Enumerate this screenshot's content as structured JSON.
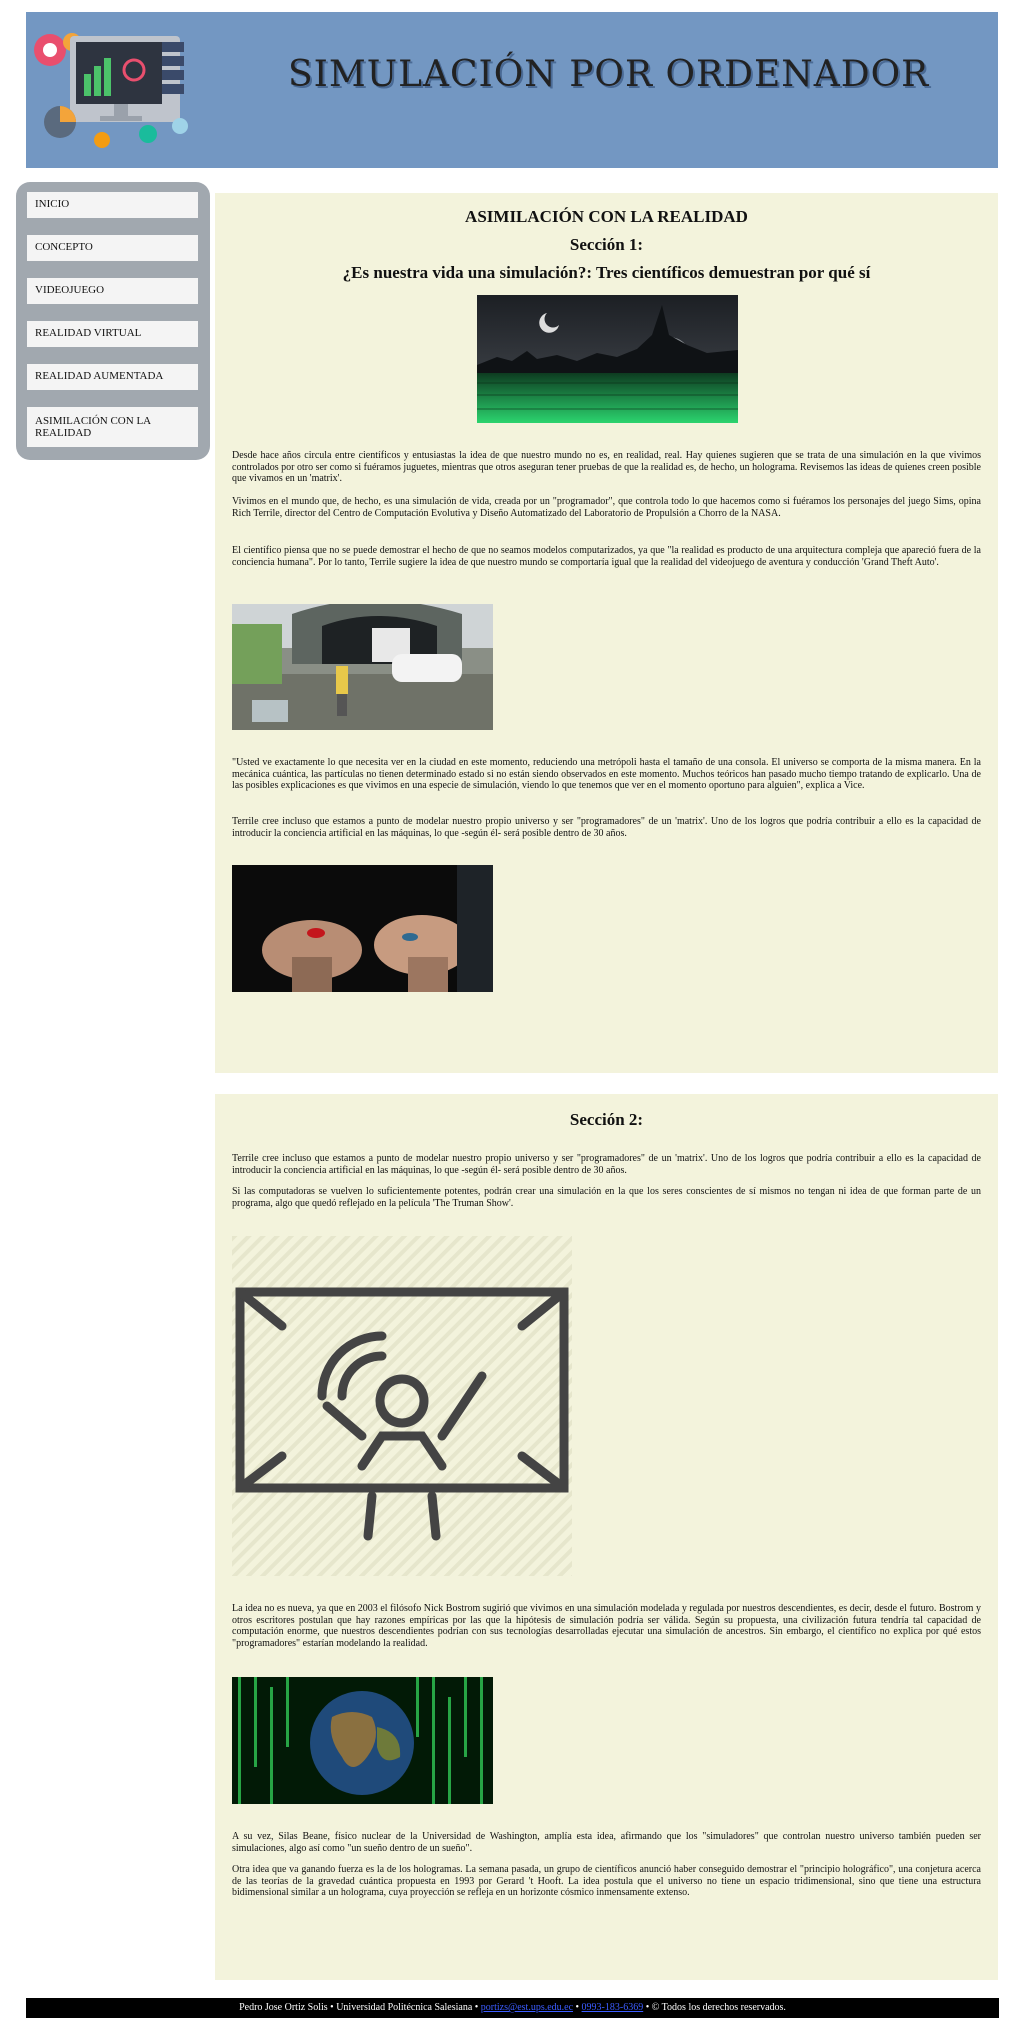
{
  "header": {
    "title": "SIMULACIÓN POR ORDENADOR",
    "logo_icon": "computer-illustration-logo"
  },
  "nav": {
    "items": [
      {
        "label": "INICIO"
      },
      {
        "label": "CONCEPTO"
      },
      {
        "label": "VIDEOJUEGO"
      },
      {
        "label": "REALIDAD VIRTUAL"
      },
      {
        "label": "REALIDAD AUMENTADA"
      },
      {
        "label": "ASIMILACIÓN CON LA REALIDAD"
      }
    ]
  },
  "section1": {
    "page_heading": "ASIMILACIÓN CON LA REALIDAD",
    "section_heading": "Sección 1:",
    "subheading": "¿Es nuestra vida una simulación?: Tres científicos demuestran por qué sí",
    "p1": "Desde hace años circula entre científicos y entusiastas la idea de que nuestro mundo no es, en realidad, real. Hay quienes sugieren que se trata de una simulación en la que vivimos controlados por otro ser como si fuéramos juguetes, mientras que otros aseguran tener pruebas de que la realidad es, de hecho, un holograma. Revisemos las ideas de quienes creen posible que vivamos en un 'matrix'.",
    "p2": "Vivimos en el mundo que, de hecho, es una simulación de vida, creada por un \"programador\", que controla todo lo que hacemos como si fuéramos los personajes del juego Sims, opina Rich Terrile, director del Centro de Computación Evolutiva y Diseño Automatizado del Laboratorio de Propulsión a Chorro de la NASA.",
    "p3": "El científico piensa que no se puede demostrar el hecho de que no seamos modelos computarizados, ya que \"la realidad es producto de una arquitectura compleja que apareció fuera de la conciencia humana\". Por lo tanto, Terrile sugiere la idea de que nuestro mundo se comportaría igual que la realidad del videojuego de aventura y conducción 'Grand Theft Auto'.",
    "p4": "\"Usted ve exactamente lo que necesita ver en la ciudad en este momento, reduciendo una metrópoli hasta el tamaño de una consola. El universo se comporta de la misma manera. En la mecánica cuántica, las partículas no tienen determinado estado si no están siendo observados en este momento. Muchos teóricos han pasado mucho tiempo tratando de explicarlo. Una de las posibles explicaciones es que vivimos en una especie de simulación, viendo lo que tenemos que ver en el momento oportuno para alguien\", explica a Vice.",
    "p5": "Terrile cree incluso que estamos a punto de modelar nuestro propio universo y ser \"programadores\" de un 'matrix'. Uno de los logros que podría contribuir a ello es la capacidad de introducir la conciencia artificial en las máquinas, lo que -según él- será posible dentro de 30 años."
  },
  "section2": {
    "section_heading": "Sección 2:",
    "p1": "Terrile cree incluso que estamos a punto de modelar nuestro propio universo y ser \"programadores\" de un 'matrix'. Uno de los logros que podría contribuir a ello es la capacidad de introducir la conciencia artificial en las máquinas, lo que -según él- será posible dentro de 30 años.",
    "p2": "Si las computadoras se vuelven lo suficientemente potentes, podrán crear una simulación en la que los seres conscientes de sí mismos no tengan ni idea de que forman parte de un programa, algo que quedó reflejado en la película 'The Truman Show'.",
    "p3": "La idea no es nueva, ya que en 2003 el filósofo Nick Bostrom sugirió que vivimos en una simulación modelada y regulada por nuestros descendientes, es decir, desde el futuro. Bostrom y otros escritores postulan que hay razones empíricas por las que la hipótesis de simulación podría ser válida. Según su propuesta, una civilización futura tendría tal capacidad de computación enorme, que nuestros descendientes podrían con sus tecnologías desarrolladas ejecutar una simulación de ancestros. Sin embargo, el científico no explica por qué estos \"programadores\" estarían modelando la realidad.",
    "p4": "A su vez, Silas Beane, físico nuclear de la Universidad de Washington, amplía esta idea, afirmando que los \"simuladores\" que controlan nuestro universo también pueden ser simulaciones, algo así como \"un sueño dentro de un sueño\".",
    "p5": "Otra idea que va ganando fuerza es la de los hologramas. La semana pasada, un grupo de científicos anunció haber conseguido demostrar el \"principio holográfico\", una conjetura acerca de las teorías de la gravedad cuántica propuesta en 1993 por Gerard 't Hooft. La idea postula que el universo no tiene un espacio tridimensional, sino que tiene una estructura bidimensional similar a un holograma, cuya proyección se refleja en un horizonte cósmico inmensamente extenso."
  },
  "footer": {
    "name": "Pedro Jose Ortiz Solis",
    "sep1": " • ",
    "university": "Universidad Politécnica Salesiana",
    "sep2": " • ",
    "email": "portizs@est.ups.edu.ec",
    "sep3": " • ",
    "phone": "0993-183-6369",
    "sep4": " • ",
    "copyright": "© Todos los derechos reservados."
  },
  "colors": {
    "header_bg": "#7397c2",
    "sidebar_bg": "#a1a8af",
    "content_bg": "#f3f3dc",
    "footer_bg": "#000000"
  }
}
